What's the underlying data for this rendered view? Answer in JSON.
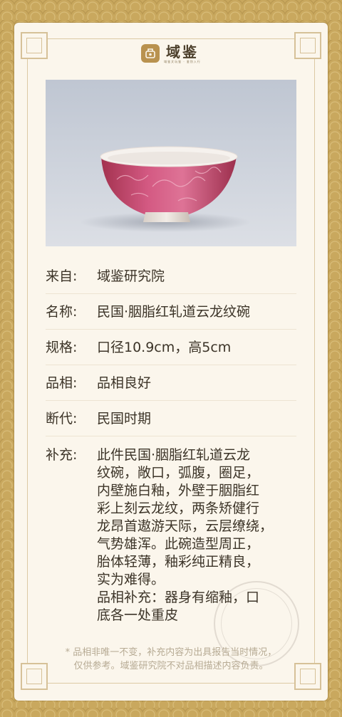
{
  "brand": {
    "name": "域鉴",
    "slogan": "域鉴文玩鉴 · 鉴别入行"
  },
  "rows": [
    {
      "label": "来自:",
      "value": "域鉴研究院"
    },
    {
      "label": "名称:",
      "value": "民国·胭脂红轧道云龙纹碗"
    },
    {
      "label": "规格:",
      "value": "口径10.9cm，高5cm"
    },
    {
      "label": "品相:",
      "value": "品相良好"
    },
    {
      "label": "断代:",
      "value": "民国时期"
    }
  ],
  "supplement": {
    "label": "补充:",
    "lines": [
      "此件民国·胭脂红轧道云龙",
      "纹碗，敞口，弧腹，圈足，",
      "内壁施白釉，外壁于胭脂红",
      "彩上刻云龙纹，两条矫健行",
      "龙昂首遨游天际，云层缭绕，",
      "气势雄浑。此碗造型周正，",
      "胎体轻薄，釉彩纯正精良，",
      "实为难得。",
      "品相补充：器身有缩釉，口",
      "底各一处重皮"
    ]
  },
  "footnote": {
    "line1": "* 品相非唯一不变，补充内容为出具报告当时情况，",
    "line2": "仅供参考。域鉴研究院不对品相描述内容负责。"
  },
  "colors": {
    "gold_border": "#c9a85e",
    "card_bg": "#fbf6ec",
    "bowl_pink": "#c8456f",
    "text": "#3c3428"
  }
}
